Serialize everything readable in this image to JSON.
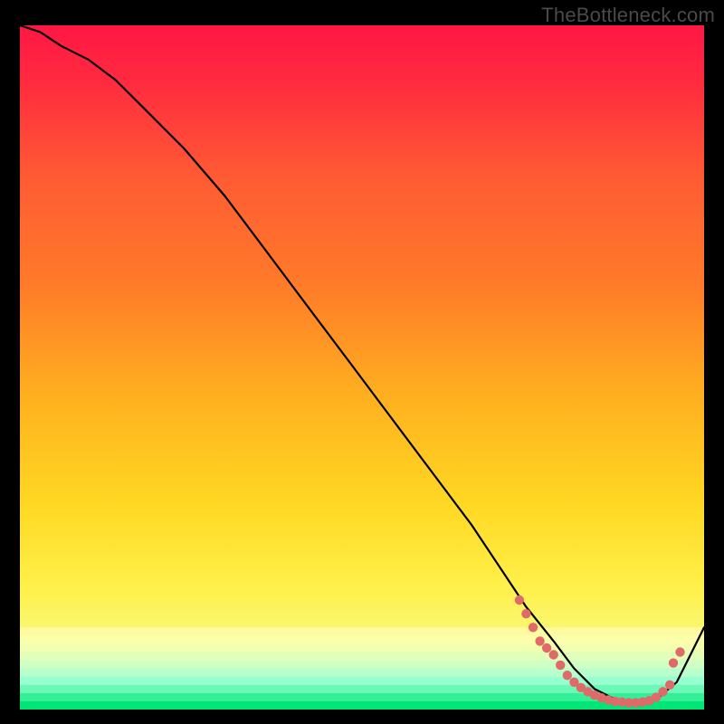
{
  "watermark": "TheBottleneck.com",
  "chart_data": {
    "type": "line",
    "title": "",
    "xlabel": "",
    "ylabel": "",
    "xlim": [
      0,
      100
    ],
    "ylim": [
      0,
      100
    ],
    "grid": false,
    "background_gradient": {
      "top": "#ff1744",
      "upper_mid": "#ff7b29",
      "mid": "#ffd823",
      "lower_mid": "#f8f97a",
      "bottom": "#00e676"
    },
    "series": [
      {
        "name": "bottleneck-curve",
        "color": "#000000",
        "x": [
          0,
          3,
          6,
          10,
          14,
          18,
          24,
          30,
          36,
          42,
          48,
          54,
          60,
          66,
          70,
          74,
          78,
          81,
          84,
          87,
          90,
          93,
          96,
          100
        ],
        "values": [
          100,
          99,
          97,
          95,
          92,
          88,
          82,
          75,
          67,
          59,
          51,
          43,
          35,
          27,
          21,
          15,
          10,
          6,
          3,
          1.5,
          1,
          1.5,
          4,
          12
        ]
      }
    ],
    "points": {
      "name": "highlighted-points",
      "color": "#e06a6a",
      "x": [
        73,
        74,
        75,
        76,
        77,
        78,
        79,
        80,
        81,
        82,
        83,
        84,
        85,
        86,
        87,
        88,
        89,
        90,
        91,
        92,
        93,
        94,
        95
      ],
      "values": [
        16,
        14,
        12,
        10,
        9,
        8,
        6.5,
        5,
        4,
        3.2,
        2.6,
        2.1,
        1.7,
        1.4,
        1.2,
        1.1,
        1.0,
        1.0,
        1.1,
        1.3,
        1.8,
        2.6,
        3.6
      ]
    },
    "extra_points": {
      "name": "outlier-points",
      "color": "#e06a6a",
      "x": [
        95.5,
        96.5
      ],
      "values": [
        6.8,
        8.4
      ]
    }
  }
}
